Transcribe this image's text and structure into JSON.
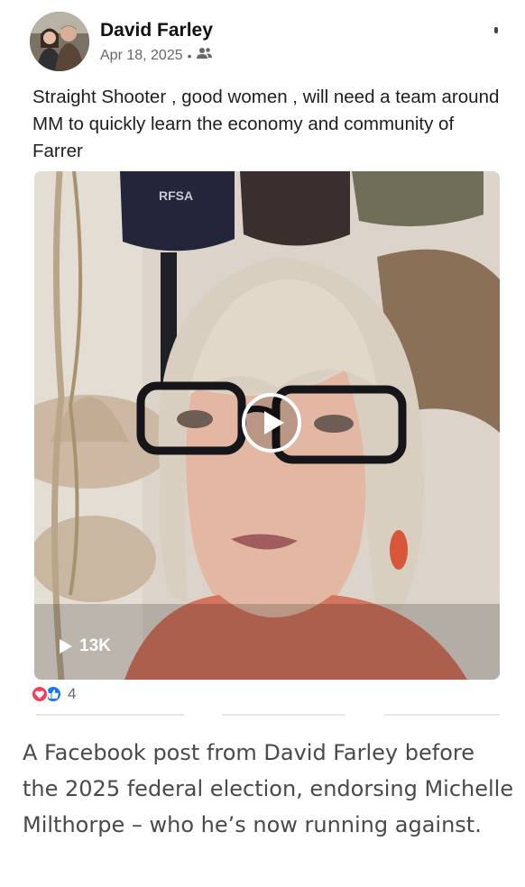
{
  "post": {
    "author": "David Farley",
    "date": "Apr 18, 2025",
    "separator": "•",
    "audience_icon": "friends-icon",
    "text": "Straight Shooter , good women , will need a team around MM to quickly learn the economy and community of Farrer",
    "video": {
      "cap_logo_text": "RFSA",
      "play_icon": "play-icon",
      "view_count": "13K"
    },
    "reactions": {
      "icons": [
        "love-reaction-icon",
        "like-reaction-icon"
      ],
      "count": "4"
    }
  },
  "caption": "A Facebook post from David Farley before the 2025 federal election, endorsing Michelle Milthorpe – who he’s now running against.",
  "colors": {
    "like_blue": "#1877f2",
    "love_red": "#f33e58",
    "meta_grey": "#65676b",
    "caption_grey": "#4a4a4a"
  }
}
